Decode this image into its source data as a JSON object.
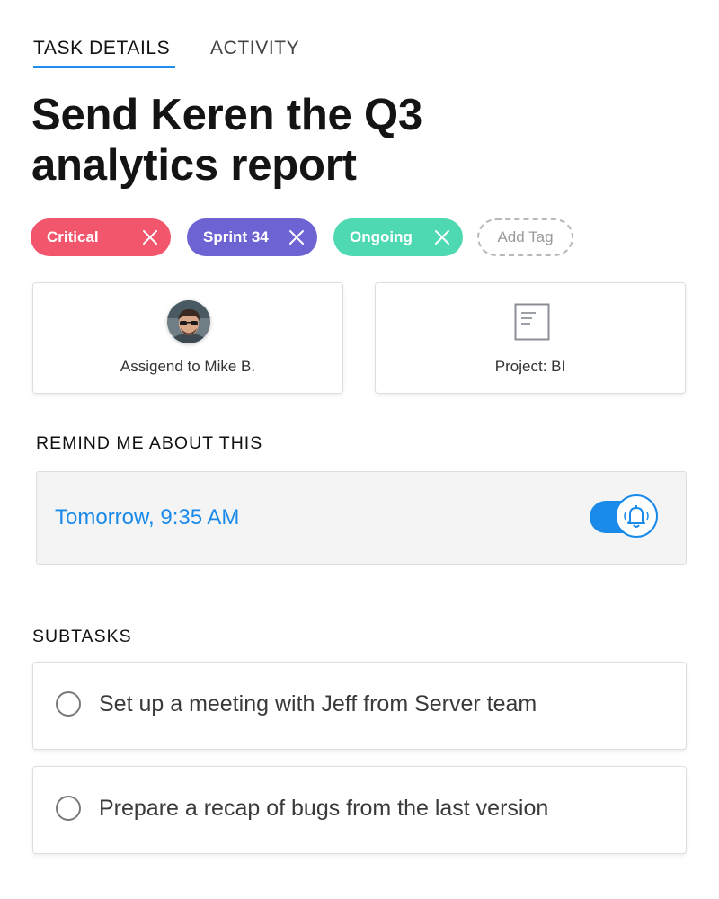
{
  "tabs": [
    {
      "label": "TASK DETAILS",
      "active": true
    },
    {
      "label": "ACTIVITY",
      "active": false
    }
  ],
  "task": {
    "title": "Send Keren the Q3 analytics report"
  },
  "tags": [
    {
      "label": "Critical",
      "color": "#f2566d"
    },
    {
      "label": "Sprint 34",
      "color": "#6e63d3"
    },
    {
      "label": "Ongoing",
      "color": "#4fd9b3"
    }
  ],
  "add_tag_label": "Add Tag",
  "assignee": {
    "label": "Assigend to Mike B.",
    "icon": "avatar-photo"
  },
  "project": {
    "label": "Project: BI",
    "icon": "document-icon"
  },
  "reminder": {
    "heading": "REMIND ME ABOUT THIS",
    "time": "Tomorrow, 9:35 AM",
    "enabled": true,
    "icon": "bell-icon"
  },
  "subtasks": {
    "heading": "SUBTASKS",
    "items": [
      {
        "label": "Set up a meeting with Jeff from Server team",
        "done": false
      },
      {
        "label": "Prepare a recap of bugs from the last version",
        "done": false
      }
    ]
  },
  "colors": {
    "accent": "#1a8aea",
    "critical": "#f2566d",
    "sprint": "#6e63d3",
    "ongoing": "#4fd9b3"
  }
}
